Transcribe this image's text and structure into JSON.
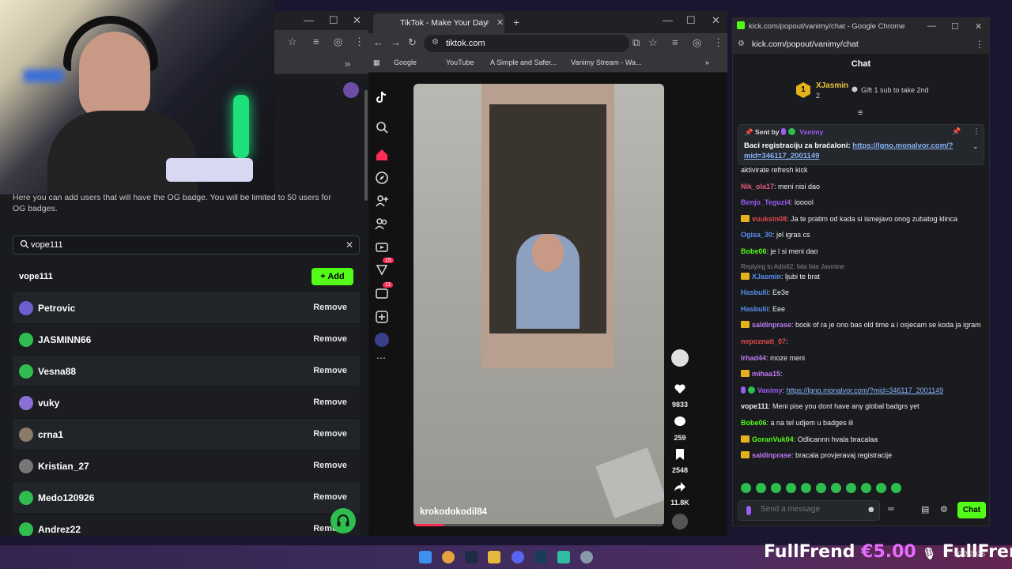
{
  "left_window": {
    "og_description": "Here you can add users that will have the OG badge. You will be limited to 50 users for OG badges.",
    "search": {
      "value": "vope111",
      "placeholder": ""
    },
    "result": {
      "username": "vope111",
      "add_label": "Add"
    },
    "users": [
      {
        "name": "Petrovic",
        "action": "Remove"
      },
      {
        "name": "JASMINN66",
        "action": "Remove"
      },
      {
        "name": "Vesna88",
        "action": "Remove"
      },
      {
        "name": "vuky",
        "action": "Remove"
      },
      {
        "name": "crna1",
        "action": "Remove"
      },
      {
        "name": "Kristian_27",
        "action": "Remove"
      },
      {
        "name": "Medo120926",
        "action": "Remove"
      },
      {
        "name": "Andrez22",
        "action": "Remove"
      }
    ]
  },
  "tiktok": {
    "tab_title": "TikTok - Make Your Day",
    "url": "tiktok.com",
    "bookmarks": [
      "Google",
      "YouTube",
      "A Simple and Safer...",
      "Vanimy Stream - Wa..."
    ],
    "video_author": "krokodokodil84",
    "likes": "9833",
    "comments": "259",
    "saves": "2548",
    "shares": "11.8K",
    "badges": {
      "following": "15",
      "messages": "11"
    }
  },
  "chat": {
    "window_title": "kick.com/popout/vanimy/chat - Google Chrome",
    "url": "kick.com/popout/vanimy/chat",
    "header": "Chat",
    "top_gifter": {
      "rank": "1",
      "name": "XJasmin",
      "count": "2",
      "cta": "Gift 1 sub to take 2nd"
    },
    "pinned": {
      "sent_by_label": "Sent by",
      "sender": "Vanimy",
      "text": "Baci registraciju za braćaloni: ",
      "link": "https://lgno.monalvor.com/?mid=346117_2001149"
    },
    "messages": [
      {
        "user": "",
        "text": "aktivirate refresh kick",
        "color": "#eeeeee",
        "badge": ""
      },
      {
        "user": "Nik_ola17",
        "text": ": meni nisi dao",
        "color": "#e05c7a",
        "badge": ""
      },
      {
        "user": "Benjo_Teguzi4",
        "text": ": looool",
        "color": "#9d5cf5",
        "badge": ""
      },
      {
        "user": "vuuksin08",
        "text": ": Ja te pratim od kada si ismejavo onog zubatog klinca",
        "color": "#e04a4a",
        "badge": "sub"
      },
      {
        "user": "Ogisa_30",
        "text": ": jel igras cs",
        "color": "#5b8ef0",
        "badge": ""
      },
      {
        "user": "Bobe06",
        "text": ": je l si meni dao",
        "color": "#53fc18",
        "badge": ""
      },
      {
        "user": "XJasmin",
        "text": ": ljubi te brat",
        "color": "#5b8ef0",
        "badge": "sub",
        "reply": "Replying to Adis62: fala fala Jasmine"
      },
      {
        "user": "Hasbulii",
        "text": ": Ee3e",
        "color": "#5b8ef0",
        "badge": ""
      },
      {
        "user": "Hasbulii",
        "text": ": Eee",
        "color": "#5b8ef0",
        "badge": ""
      },
      {
        "user": "saldinprase",
        "text": ": book of ra je ono bas old time a i osjecam se koda ja igram",
        "color": "#c07cf5",
        "badge": "sub"
      },
      {
        "user": "nepoznati_07",
        "text": ":",
        "color": "#e04a4a",
        "badge": ""
      },
      {
        "user": "Irhad44",
        "text": ": moze meni",
        "color": "#c07cf5",
        "badge": ""
      },
      {
        "user": "mihaa15",
        "text": ":",
        "color": "#c07cf5",
        "badge": "sub"
      },
      {
        "user": "Vanimy",
        "text": ": ",
        "color": "#9d5cf5",
        "badge": "mod",
        "link": "https://lgno.monalvor.com/?mid=346117_2001149"
      },
      {
        "user": "vope111",
        "text": ": Meni pise you dont have any global badgrs yet",
        "color": "#eeeeee",
        "badge": ""
      },
      {
        "user": "Bobe06",
        "text": ": a na tel udjem u badges ili",
        "color": "#53fc18",
        "badge": ""
      },
      {
        "user": "GoranVuk04",
        "text": ": Odlicannn hvala bracalaa",
        "color": "#53fc18",
        "badge": "sub"
      },
      {
        "user": "saldinprase",
        "text": ": bracala provjeravaj registracije",
        "color": "#c07cf5",
        "badge": "sub"
      }
    ],
    "input_placeholder": "Send a message",
    "send_label": "Chat"
  },
  "overlay": {
    "banner_name": "FullFrend",
    "banner_amount": "€5.00",
    "clock": "1/12/2026"
  },
  "colors": {
    "kick_green": "#53fc18",
    "tiktok_red": "#fe2c55"
  }
}
